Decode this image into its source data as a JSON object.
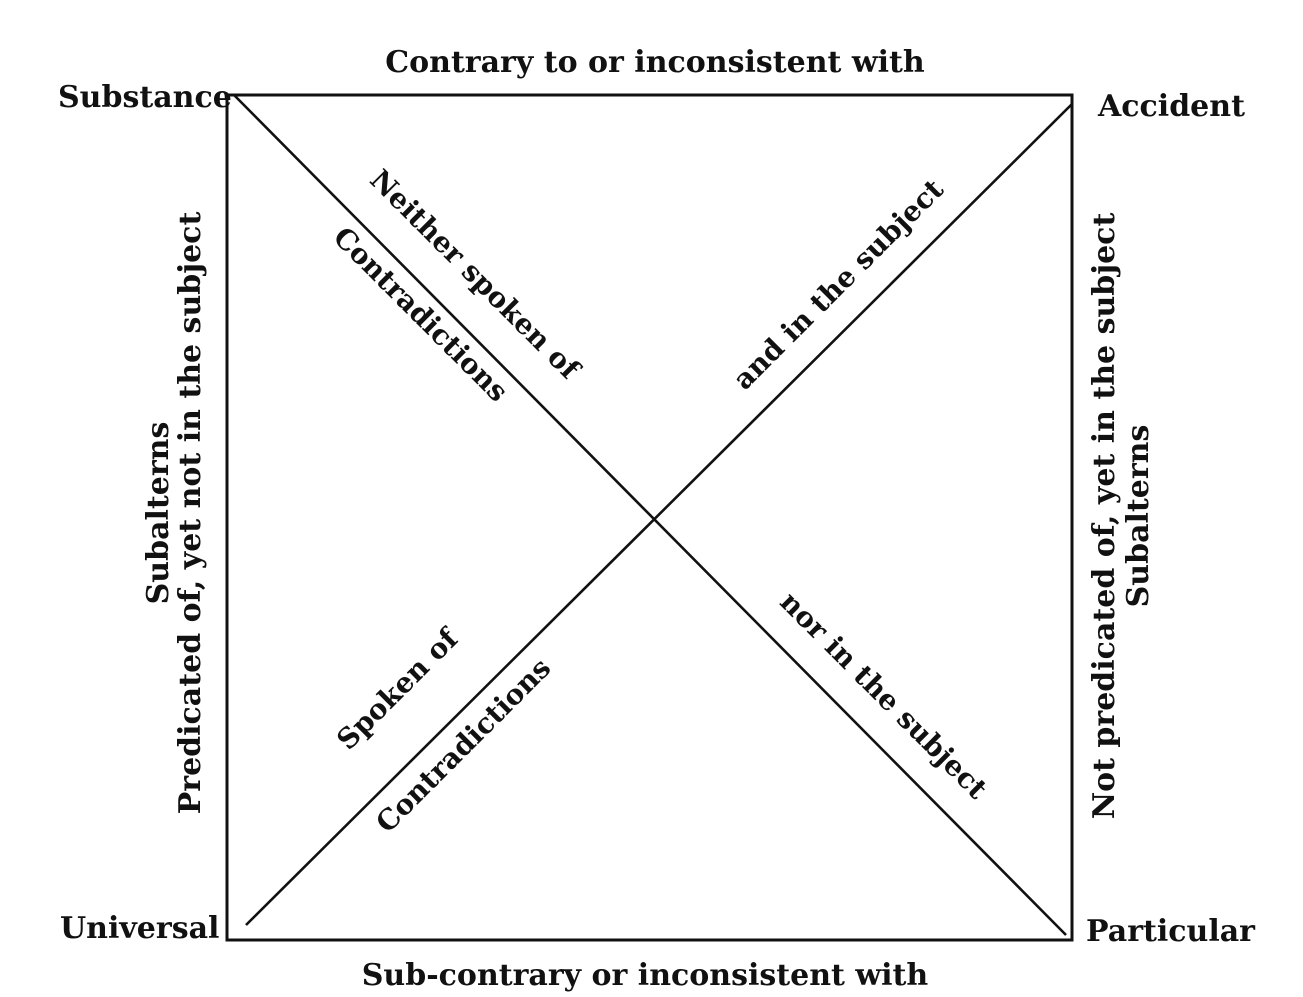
{
  "corners": {
    "top_left": "Substance",
    "top_right": "Accident",
    "bottom_left": "Universal",
    "bottom_right": "Particular"
  },
  "edges": {
    "top": "Contrary to or inconsistent with",
    "bottom": "Sub-contrary or inconsistent with",
    "left_outer": "Subalterns",
    "left_inner": "Predicated of, yet not in the subject",
    "right_inner": "Not predicated of, yet in the subject",
    "right_outer": "Subalterns"
  },
  "diagonals": {
    "upper_left_a": "Neither spoken of",
    "upper_left_b": "Contradictions",
    "upper_right": "and in the subject",
    "lower_left_a": "Spoken of",
    "lower_left_b": "Contradictions",
    "lower_right": "nor in the subject"
  }
}
